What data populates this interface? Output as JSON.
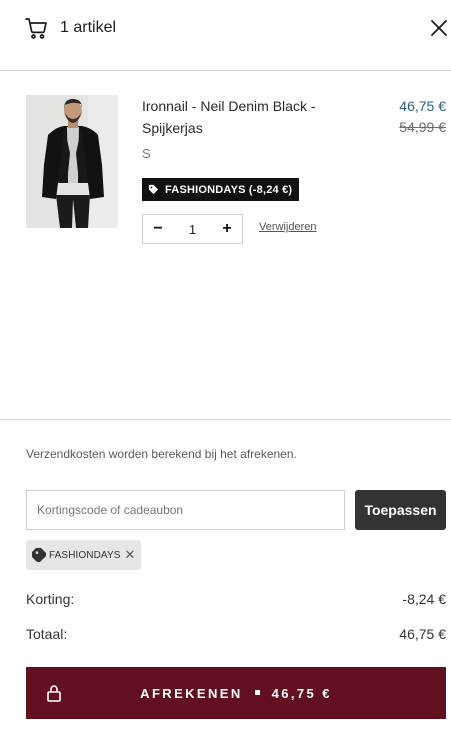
{
  "header": {
    "icon": "shopping-cart-icon",
    "title": "1 artikel",
    "close_icon": "close-icon"
  },
  "item": {
    "name": "Ironnail - Neil Denim Black - Spijkerjas",
    "price_current": "46,75 €",
    "price_old": "54,99 €",
    "size": "S",
    "discount_tag": "FASHIONDAYS (-8,24 €)",
    "quantity": "1",
    "minus": "−",
    "plus": "+",
    "remove_label": "Verwijderen"
  },
  "footer": {
    "shipping_note": "Verzendkosten worden berekend bij het afrekenen.",
    "coupon_placeholder": "Kortingscode of cadeaubon",
    "apply_label": "Toepassen",
    "applied_code": "FASHIONDAYS",
    "applied_remove": "✕",
    "discount_label": "Korting:",
    "discount_value": "-8,24 €",
    "total_label": "Totaal:",
    "total_value": "46,75 €",
    "checkout_label": "AFREKENEN",
    "checkout_amount": "46,75 €"
  },
  "colors": {
    "price_accent": "#2b5e85",
    "checkout_bg": "#620f20",
    "discount_tag_bg": "#111111",
    "apply_bg": "#333333"
  }
}
